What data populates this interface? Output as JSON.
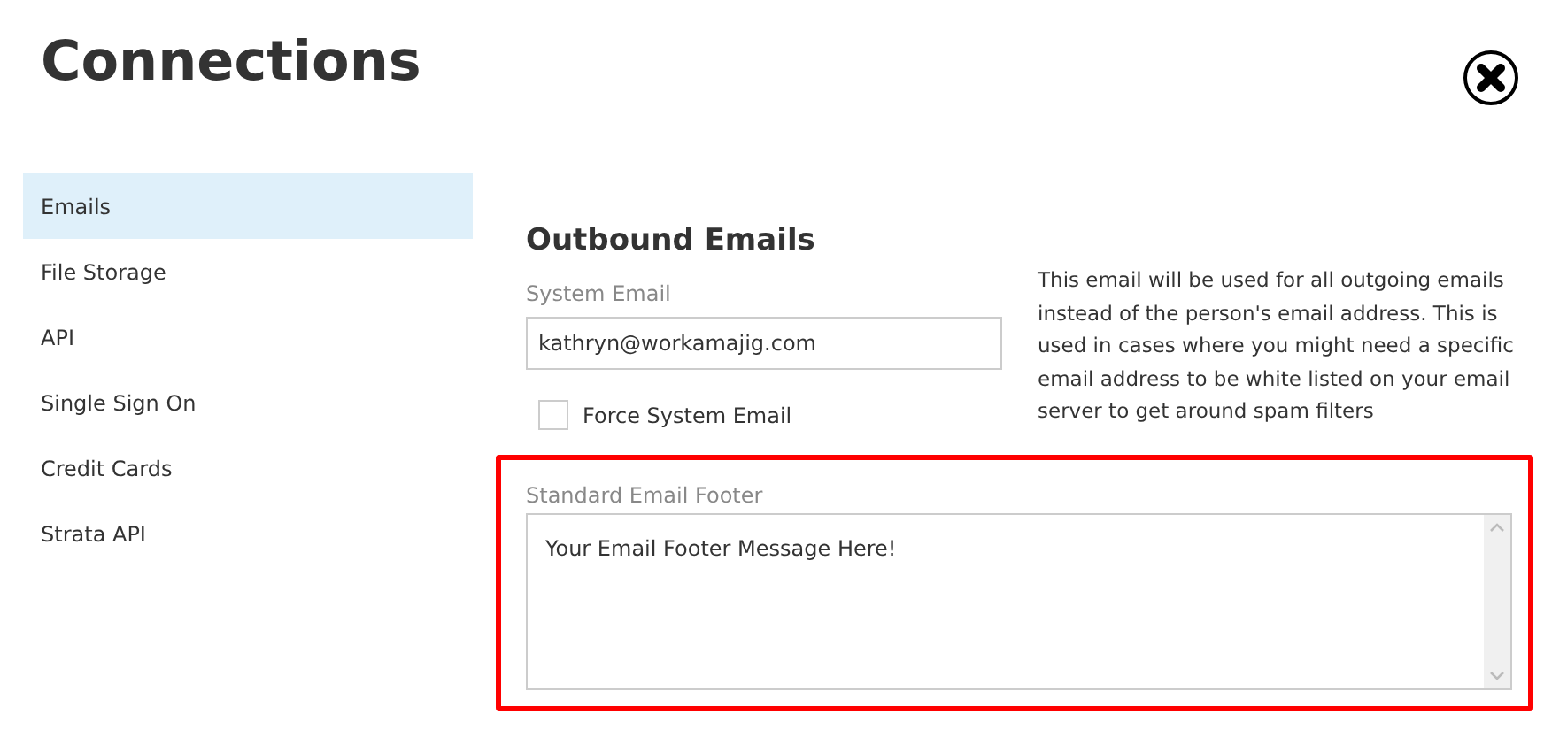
{
  "title": "Connections",
  "sidebar": {
    "items": [
      {
        "label": "Emails",
        "selected": true
      },
      {
        "label": "File Storage",
        "selected": false
      },
      {
        "label": "API",
        "selected": false
      },
      {
        "label": "Single Sign On",
        "selected": false
      },
      {
        "label": "Credit Cards",
        "selected": false
      },
      {
        "label": "Strata API",
        "selected": false
      }
    ]
  },
  "section": {
    "heading": "Outbound Emails",
    "system_email": {
      "label": "System Email",
      "value": "kathryn@workamajig.com"
    },
    "force_system_email": {
      "label": "Force System Email",
      "checked": false
    },
    "description": "This email will be used for all outgoing emails instead of the person's email address. This is used in cases where you might need a specific email address to be white listed on your email server to get around spam filters",
    "footer": {
      "label": "Standard Email Footer",
      "value": "Your Email Footer Message Here!",
      "highlighted": true
    }
  }
}
